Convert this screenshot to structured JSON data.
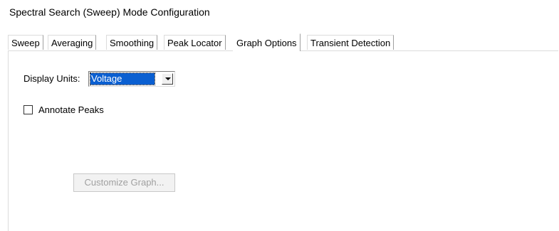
{
  "window": {
    "title": "Spectral Search (Sweep) Mode Configuration"
  },
  "tabs": [
    {
      "label": "Sweep",
      "active": false
    },
    {
      "label": "Averaging",
      "active": false
    },
    {
      "label": "Smoothing",
      "active": false
    },
    {
      "label": "Peak Locator",
      "active": false
    },
    {
      "label": "Graph Options",
      "active": true
    },
    {
      "label": "Transient Detection",
      "active": false
    }
  ],
  "graph_options": {
    "display_units_label": "Display Units:",
    "display_units_value": "Voltage",
    "annotate_peaks_label": "Annotate Peaks",
    "annotate_peaks_checked": false,
    "customize_button_label": "Customize Graph...",
    "customize_button_enabled": false
  },
  "colors": {
    "selection": "#0a5fd1",
    "disabled_text": "#a0a0a0"
  }
}
